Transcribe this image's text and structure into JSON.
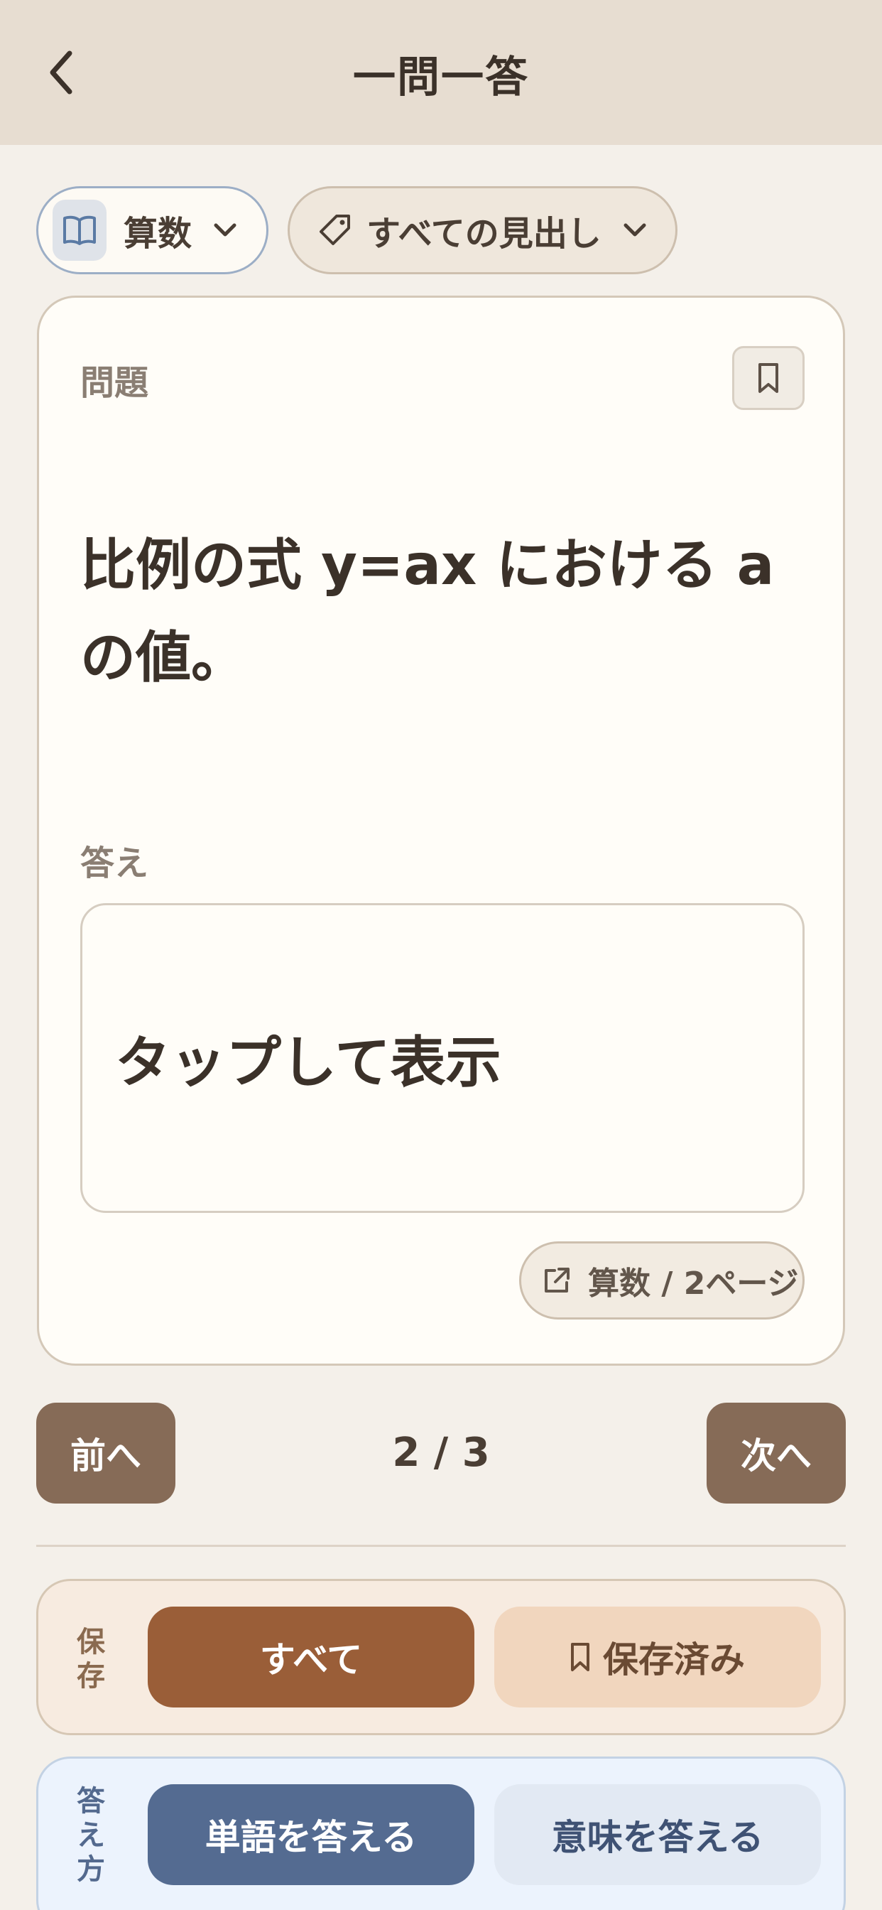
{
  "header": {
    "title": "一問一答"
  },
  "filters": {
    "subject": {
      "label": "算数"
    },
    "heading": {
      "label": "すべての見出し"
    }
  },
  "card": {
    "question_label": "問題",
    "question_text": "比例の式 y=ax における a の値。",
    "answer_label": "答え",
    "answer_placeholder": "タップして表示",
    "source": "算数 / 2ページ"
  },
  "navigation": {
    "prev_label": "前へ",
    "next_label": "次へ",
    "counter": "2 / 3"
  },
  "save_filter": {
    "label": "保存",
    "options": [
      "すべて",
      "保存済み"
    ],
    "selected": "すべて"
  },
  "answer_mode": {
    "label": "答え方",
    "options": [
      "単語を答える",
      "意味を答える"
    ],
    "selected": "単語を答える"
  },
  "colors": {
    "header_bg": "#e7ddd1",
    "nav_button": "#866b57",
    "save_active": "#9a5e38",
    "mode_active": "#546b91"
  },
  "icons": [
    "back-arrow-icon",
    "book-icon",
    "chevron-down-icon",
    "tag-icon",
    "bookmark-icon",
    "external-link-icon"
  ]
}
